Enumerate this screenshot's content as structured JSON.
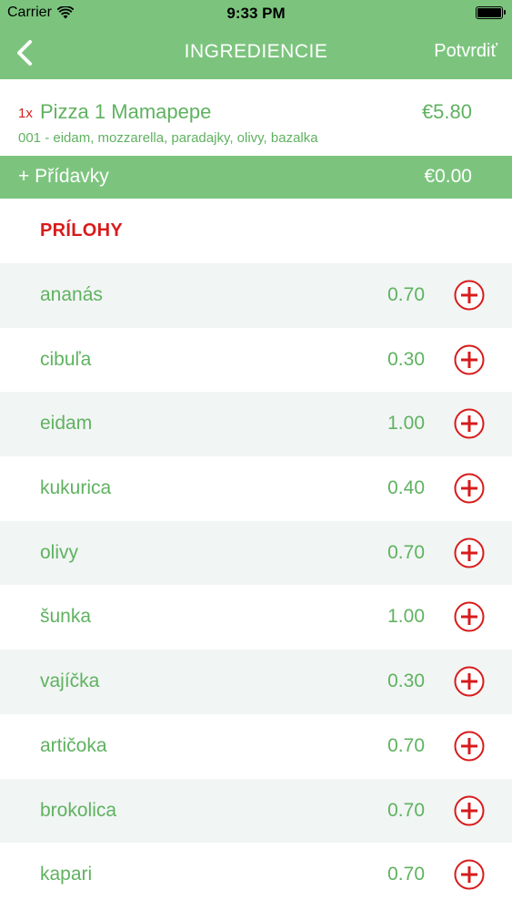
{
  "status_bar": {
    "carrier": "Carrier",
    "time": "9:33 PM"
  },
  "nav": {
    "title": "INGREDIENCIE",
    "confirm_label": "Potvrdiť"
  },
  "order": {
    "quantity": "1x",
    "name": "Pizza 1 Mamapepe",
    "price": "€5.80",
    "description": "001 - eidam, mozzarella, paradajky, olivy, bazalka"
  },
  "extras": {
    "label": "+ Přídavky",
    "price": "€0.00"
  },
  "section": {
    "title": "PRÍLOHY"
  },
  "items": [
    {
      "name": "ananás",
      "price": "0.70"
    },
    {
      "name": "cibuľa",
      "price": "0.30"
    },
    {
      "name": "eidam",
      "price": "1.00"
    },
    {
      "name": "kukurica",
      "price": "0.40"
    },
    {
      "name": "olivy",
      "price": "0.70"
    },
    {
      "name": "šunka",
      "price": "1.00"
    },
    {
      "name": "vajíčka",
      "price": "0.30"
    },
    {
      "name": "artičoka",
      "price": "0.70"
    },
    {
      "name": "brokolica",
      "price": "0.70"
    },
    {
      "name": "kapari",
      "price": "0.70"
    }
  ],
  "colors": {
    "header_green": "#7cc47e",
    "text_green": "#5fb260",
    "accent_red": "#d81b1b",
    "row_alt": "#f1f5f4"
  },
  "icons": {
    "back": "chevron-left-icon",
    "add": "plus-circle-icon",
    "wifi": "wifi-icon",
    "battery": "battery-icon"
  }
}
